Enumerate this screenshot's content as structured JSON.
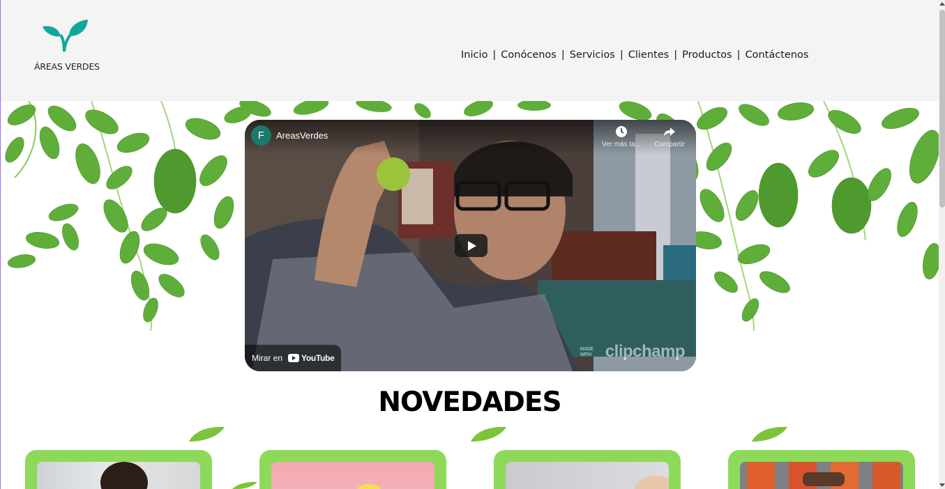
{
  "brand": {
    "name": "ÁREAS VERDES",
    "logo_icon": "sprout-icon",
    "accent_color": "#10a89a"
  },
  "nav": {
    "items": [
      {
        "label": "Inicio"
      },
      {
        "label": "Conócenos"
      },
      {
        "label": "Servicios"
      },
      {
        "label": "Clientes"
      },
      {
        "label": "Productos"
      },
      {
        "label": "Contáctenos"
      }
    ],
    "separator": "|"
  },
  "video": {
    "channel_initial": "F",
    "channel_name": "AreasVerdes",
    "watch_later_label": "Ver más ta...",
    "share_label": "Compartir",
    "watch_on_label": "Mirar en",
    "platform_label": "YouTube",
    "watermark_small": "MADE WITH",
    "watermark": "clipchamp",
    "play_icon": "play-icon"
  },
  "novedades": {
    "title": "NOVEDADES",
    "card_color": "#8ed95a",
    "leaf_color": "#7cc43a"
  }
}
